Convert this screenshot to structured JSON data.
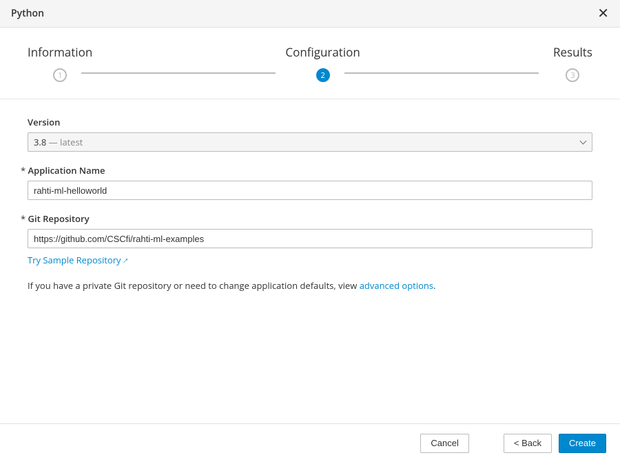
{
  "header": {
    "title": "Python"
  },
  "wizard": {
    "steps": [
      {
        "label": "Information",
        "num": "1"
      },
      {
        "label": "Configuration",
        "num": "2"
      },
      {
        "label": "Results",
        "num": "3"
      }
    ]
  },
  "form": {
    "version_label": "Version",
    "version_value": "3.8",
    "version_suffix": " — latest",
    "appname_label": "Application Name",
    "appname_value": "rahti-ml-helloworld",
    "gitrepo_label": "Git Repository",
    "gitrepo_value": "https://github.com/CSCfi/rahti-ml-examples",
    "try_sample": "Try Sample Repository",
    "help_pre": "If you have a private Git repository or need to change application defaults, view ",
    "help_link": "advanced options",
    "help_post": "."
  },
  "footer": {
    "cancel": "Cancel",
    "back": "< Back",
    "create": "Create"
  }
}
